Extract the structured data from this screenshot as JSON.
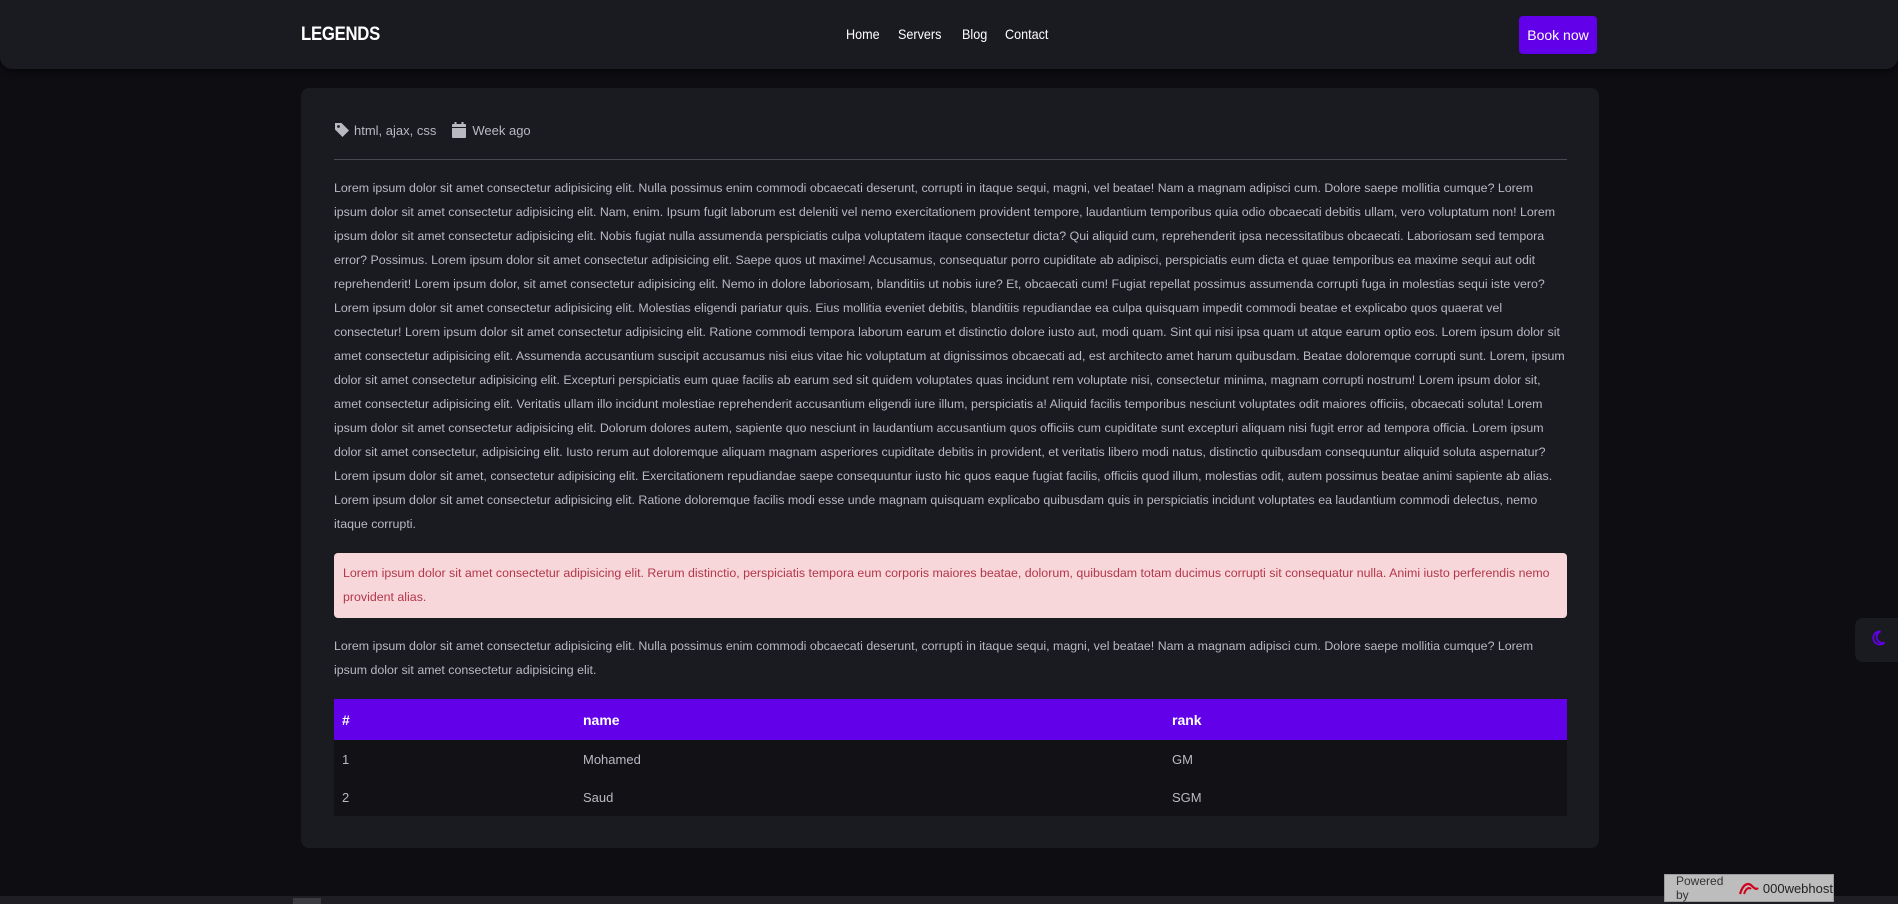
{
  "nav": {
    "brand": "LEGENDS",
    "links": [
      "Home",
      "Servers",
      "Blog",
      "Contact"
    ],
    "cta": "Book now"
  },
  "post": {
    "tags": "html, ajax, css",
    "date": "Week ago",
    "body": "Lorem ipsum dolor sit amet consectetur adipisicing elit. Nulla possimus enim commodi obcaecati deserunt, corrupti in itaque sequi, magni, vel beatae! Nam a magnam adipisci cum. Dolore saepe mollitia cumque? Lorem ipsum dolor sit amet consectetur adipisicing elit. Nam, enim. Ipsum fugit laborum est deleniti vel nemo exercitationem provident tempore, laudantium temporibus quia odio obcaecati debitis ullam, vero voluptatum non! Lorem ipsum dolor sit amet consectetur adipisicing elit. Nobis fugiat nulla assumenda perspiciatis culpa voluptatem itaque consectetur dicta? Qui aliquid cum, reprehenderit ipsa necessitatibus obcaecati. Laboriosam sed tempora error? Possimus. Lorem ipsum dolor sit amet consectetur adipisicing elit. Saepe quos ut maxime! Accusamus, consequatur porro cupiditate ab adipisci, perspiciatis eum dicta et quae temporibus ea maxime sequi aut odit reprehenderit! Lorem ipsum dolor, sit amet consectetur adipisicing elit. Nemo in dolore laboriosam, blanditiis ut nobis iure? Et, obcaecati cum! Fugiat repellat possimus assumenda corrupti fuga in molestias sequi iste vero? Lorem ipsum dolor sit amet consectetur adipisicing elit. Molestias eligendi pariatur quis. Eius mollitia eveniet debitis, blanditiis repudiandae ea culpa quisquam impedit commodi beatae et explicabo quos quaerat vel consectetur! Lorem ipsum dolor sit amet consectetur adipisicing elit. Ratione commodi tempora laborum earum et distinctio dolore iusto aut, modi quam. Sint qui nisi ipsa quam ut atque earum optio eos. Lorem ipsum dolor sit amet consectetur adipisicing elit. Assumenda accusantium suscipit accusamus nisi eius vitae hic voluptatum at dignissimos obcaecati ad, est architecto amet harum quibusdam. Beatae doloremque corrupti sunt. Lorem, ipsum dolor sit amet consectetur adipisicing elit. Excepturi perspiciatis eum quae facilis ab earum sed sit quidem voluptates quas incidunt rem voluptate nisi, consectetur minima, magnam corrupti nostrum! Lorem ipsum dolor sit, amet consectetur adipisicing elit. Veritatis ullam illo incidunt molestiae reprehenderit accusantium eligendi iure illum, perspiciatis a! Aliquid facilis temporibus nesciunt voluptates odit maiores officiis, obcaecati soluta! Lorem ipsum dolor sit amet consectetur adipisicing elit. Dolorum dolores autem, sapiente quo nesciunt in laudantium accusantium quos officiis cum cupiditate sunt excepturi aliquam nisi fugit error ad tempora officia. Lorem ipsum dolor sit amet consectetur, adipisicing elit. Iusto rerum aut doloremque aliquam magnam asperiores cupiditate debitis in provident, et veritatis libero modi natus, distinctio quibusdam consequuntur aliquid soluta aspernatur? Lorem ipsum dolor sit amet, consectetur adipisicing elit. Exercitationem repudiandae saepe consequuntur iusto hic quos eaque fugiat facilis, officiis quod illum, molestias odit, autem possimus beatae animi sapiente ab alias. Lorem ipsum dolor sit amet consectetur adipisicing elit. Ratione doloremque facilis modi esse unde magnam quisquam explicabo quibusdam quis in perspiciatis incidunt voluptates ea laudantium commodi delectus, nemo itaque corrupti.",
    "alert": "Lorem ipsum dolor sit amet consectetur adipisicing elit. Rerum distinctio, perspiciatis tempora eum corporis maiores beatae, dolorum, quibusdam totam ducimus corrupti sit consequatur nulla. Animi iusto perferendis nemo provident alias.",
    "body2": "Lorem ipsum dolor sit amet consectetur adipisicing elit. Nulla possimus enim commodi obcaecati deserunt, corrupti in itaque sequi, magni, vel beatae! Nam a magnam adipisci cum. Dolore saepe mollitia cumque? Lorem ipsum dolor sit amet consectetur adipisicing elit."
  },
  "table": {
    "headers": [
      "#",
      "name",
      "rank"
    ],
    "rows": [
      [
        "1",
        "Mohamed",
        "GM"
      ],
      [
        "2",
        "Saud",
        "SGM"
      ]
    ]
  },
  "footer": {
    "powered_label": "Powered by",
    "host_name": "000webhost"
  },
  "colors": {
    "accent": "#6200ea",
    "background": "#0d0d12",
    "card": "#1a1a21",
    "alert_bg": "#f8d7da",
    "alert_text": "#b3364a"
  },
  "icons": {
    "tag": "tag-icon",
    "date": "calendar-icon",
    "theme": "moon-icon",
    "host_logo": "000webhost-logo-icon"
  }
}
